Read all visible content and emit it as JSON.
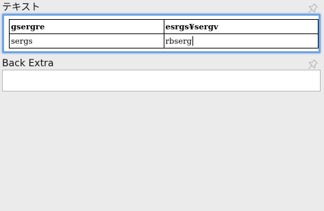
{
  "fields": [
    {
      "label": "テキスト",
      "focused": true,
      "table": {
        "header": [
          "gsergre",
          "esrgs¥sergv"
        ],
        "rows": [
          [
            "sergs",
            "rbserg"
          ]
        ]
      }
    },
    {
      "label": "Back Extra",
      "focused": false,
      "value": ""
    }
  ],
  "icons": {
    "pin": "pushpin-icon"
  },
  "colors": {
    "background": "#ebebeb",
    "focus_border": "#70a4e4",
    "editor_background": "#ffffff",
    "pin": "#b9b9b9"
  }
}
